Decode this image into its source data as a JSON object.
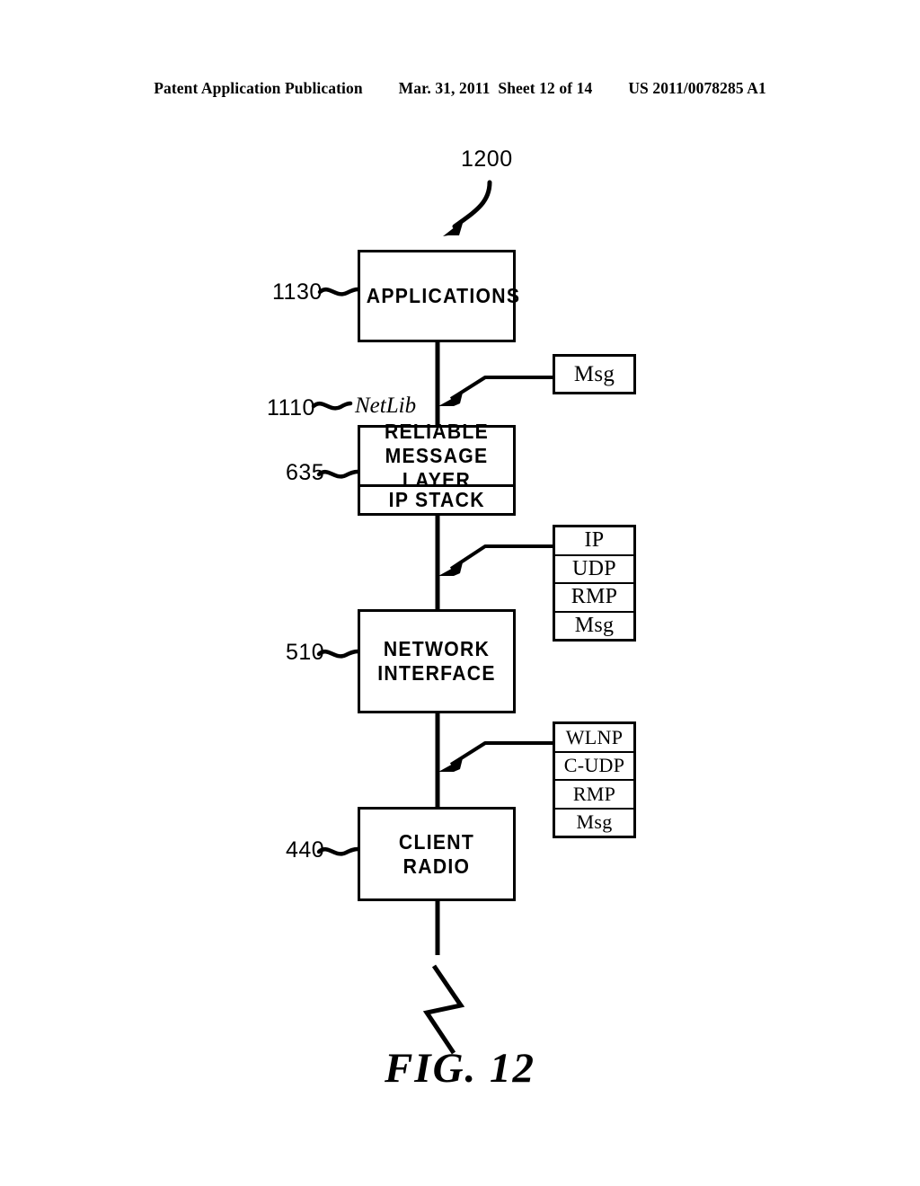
{
  "header": {
    "publication": "Patent Application Publication",
    "date_sheet": "Mar. 31, 2011  Sheet 12 of 14",
    "pub_number": "US 2011/0078285 A1"
  },
  "figure": {
    "caption": "FIG. 12",
    "system_ref": "1200",
    "blocks": [
      {
        "ref": "1130",
        "label": "APPLICATIONS",
        "name": "applications-block"
      },
      {
        "ref": "635",
        "label_upper_line1": "RELIABLE",
        "label_upper_line2": "MESSAGE  LAYER",
        "label_lower": "IP  STACK",
        "name": "reliable-message-layer-block"
      },
      {
        "ref": "510",
        "label_line1": "NETWORK",
        "label_line2": "INTERFACE",
        "name": "network-interface-block"
      },
      {
        "ref": "440",
        "label": "CLIENT  RADIO",
        "name": "client-radio-block"
      }
    ],
    "netlib": {
      "ref": "1110",
      "label": "NetLib"
    },
    "protocol_stacks": [
      {
        "name": "msg-packet-stack",
        "layers": [
          "Msg"
        ]
      },
      {
        "name": "ip-packet-stack",
        "layers": [
          "IP",
          "UDP",
          "RMP",
          "Msg"
        ]
      },
      {
        "name": "wlnp-packet-stack",
        "layers": [
          "WLNP",
          "C-UDP",
          "RMP",
          "Msg"
        ]
      }
    ],
    "colors": {
      "ink": "#000000",
      "paper": "#ffffff"
    }
  }
}
